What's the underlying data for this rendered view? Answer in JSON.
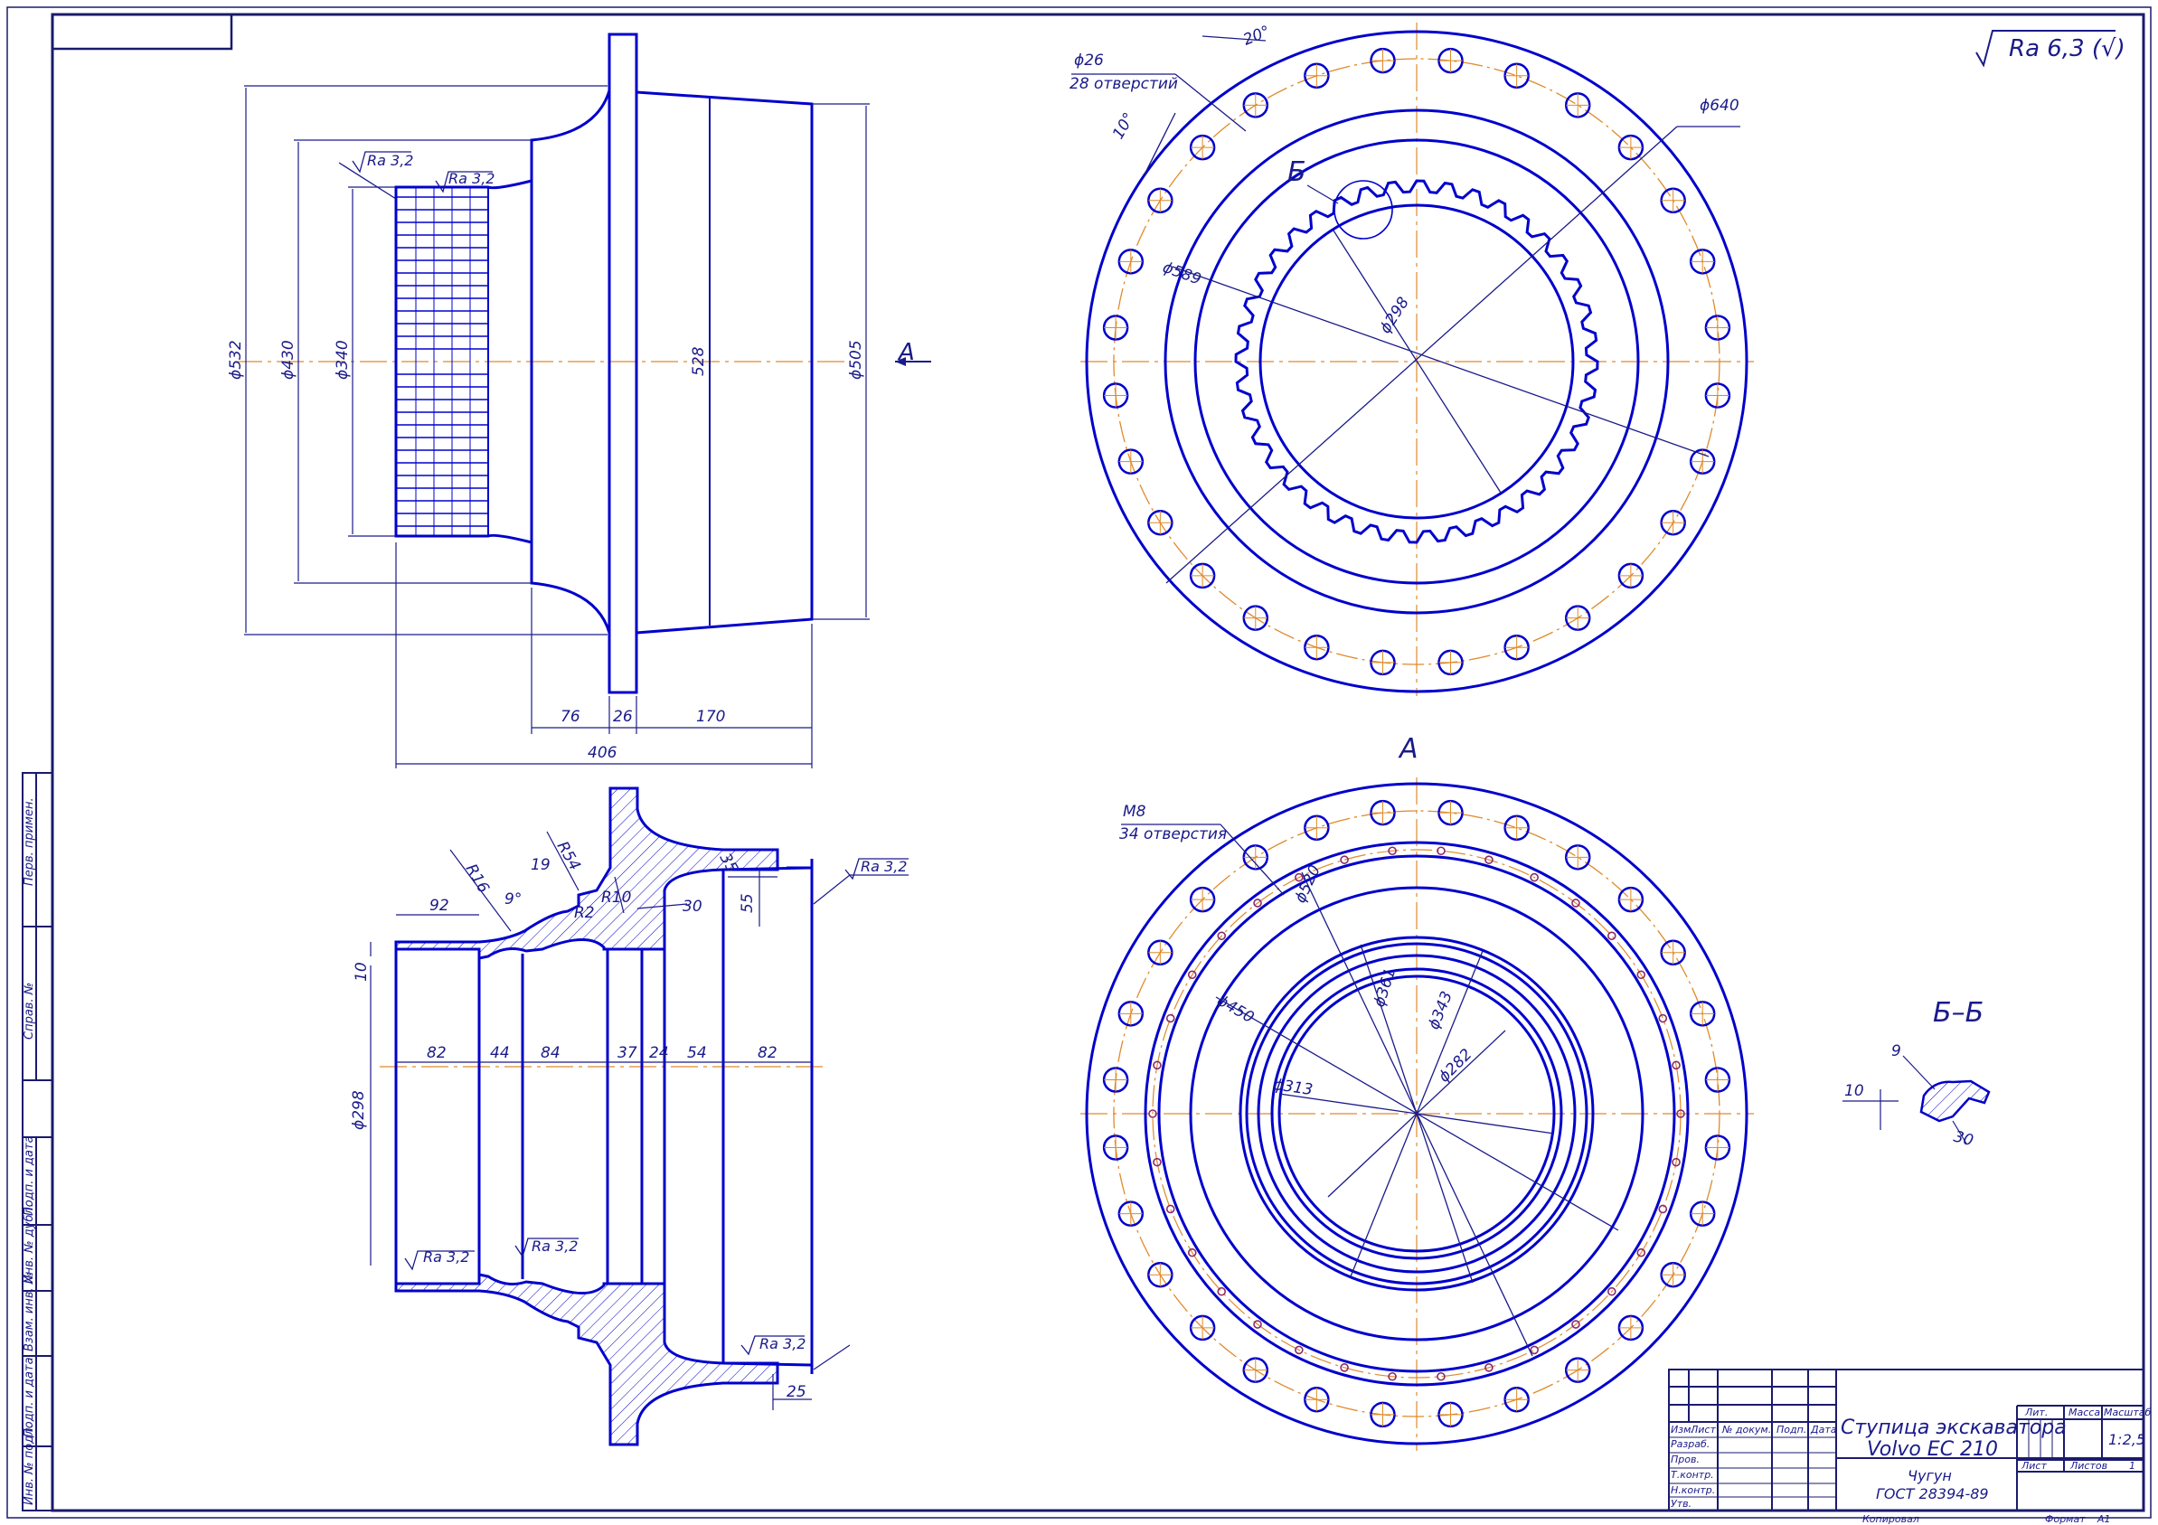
{
  "roughness": {
    "general": "Ra 6,3 (√)",
    "surface": "Ra 3,2"
  },
  "view_a_label": "A",
  "section_bb_label": "Б–Б",
  "detail_b_label": "Б",
  "colors": {
    "line": "#0000cc",
    "axis": "#e08a2a",
    "frame": "#1a1a6e",
    "hole": "#8a2a6a"
  },
  "side_view": {
    "dims": {
      "d532": "ϕ532",
      "d430": "ϕ430",
      "d340": "ϕ340",
      "d528": "528",
      "d505": "ϕ505",
      "l76": "76",
      "l26": "26",
      "l170": "170",
      "l406": "406"
    },
    "section_arrow": "A"
  },
  "front_view": {
    "holes_note_1": "ϕ26",
    "holes_note_2": "28 отверстий",
    "angle_20": "20°",
    "angle_10": "10°",
    "d640": "ϕ640",
    "d589": "ϕ589",
    "d298": "ϕ298"
  },
  "section_view": {
    "dims": {
      "r16": "R16",
      "r54": "R54",
      "d19": "19",
      "a9": "9°",
      "r2": "R2",
      "r10": "R10",
      "d30": "30",
      "d55": "55",
      "d35": "35",
      "d92": "92",
      "d10": "10",
      "d298": "ϕ298",
      "s82a": "82",
      "s44": "44",
      "s84": "84",
      "s37": "37",
      "s24": "24",
      "s54": "54",
      "s82b": "82",
      "d25": "25"
    }
  },
  "view_a": {
    "m8_note_1": "M8",
    "m8_note_2": "34 отверстия",
    "d520": "ϕ520",
    "d450": "ϕ450",
    "d361": "ϕ361",
    "d343": "ϕ343",
    "d313": "ϕ313",
    "d282": "ϕ282"
  },
  "section_bb": {
    "d9": "9",
    "d10": "10",
    "d30": "30"
  },
  "side_stamps": [
    "Перв. примен.",
    "Справ. №",
    "Подп. и дата",
    "Инв. № дубл.",
    "Взам. инв. №",
    "Подп. и дата",
    "Инв. № подл."
  ],
  "title_block": {
    "title_line1": "Ступица экскаватора",
    "title_line2": "Volvo EC 210",
    "material_line1": "Чугун",
    "material_line2": "ГОСТ 28394-89",
    "col_izm": "Изм.",
    "col_list": "Лист",
    "col_doc": "№ докум.",
    "col_podp": "Подп.",
    "col_date": "Дата",
    "row_razrab": "Разраб.",
    "row_prov": "Пров.",
    "row_tkontr": "Т.контр.",
    "row_nkontr": "Н.контр.",
    "row_utv": "Утв.",
    "lit_label": "Лит.",
    "mass_label": "Масса",
    "scale_label": "Масштаб",
    "scale_value": "1:2,5",
    "sheet_label": "Лист",
    "sheets_label": "Листов",
    "sheets_value": "1",
    "copied_label": "Копировал",
    "format_label": "Формат",
    "format_value": "А1"
  }
}
